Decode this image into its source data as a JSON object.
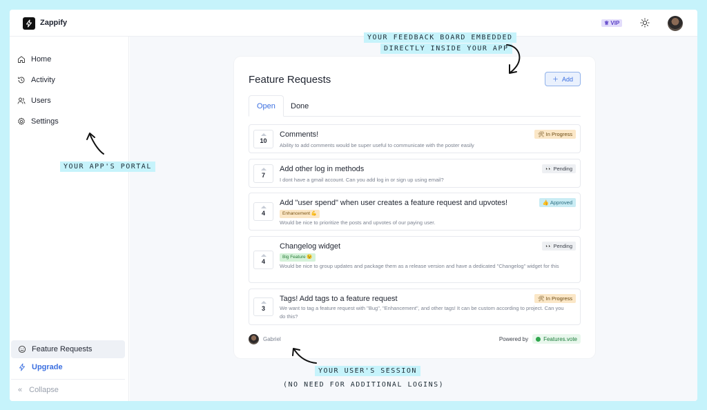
{
  "app": {
    "name": "Zappify",
    "vip_label": "VIP"
  },
  "sidebar": {
    "items": [
      {
        "label": "Home",
        "icon": "home-icon"
      },
      {
        "label": "Activity",
        "icon": "history-icon"
      },
      {
        "label": "Users",
        "icon": "users-icon"
      },
      {
        "label": "Settings",
        "icon": "gear-icon"
      }
    ],
    "feature_requests_label": "Feature Requests",
    "upgrade_label": "Upgrade",
    "collapse_label": "Collapse"
  },
  "board": {
    "title": "Feature Requests",
    "add_label": "Add",
    "tabs": [
      {
        "label": "Open",
        "active": true
      },
      {
        "label": "Done",
        "active": false
      }
    ],
    "requests": [
      {
        "votes": "10",
        "title": "Comments!",
        "tag": "",
        "desc": "Ability to add comments would be super useful to communicate with the poster easily",
        "status": "🛠 In Progress"
      },
      {
        "votes": "7",
        "title": "Add other log in methods",
        "tag": "",
        "desc": "I dont have a gmail account. Can you add log in or sign up using email?",
        "status": "👀 Pending"
      },
      {
        "votes": "4",
        "title": "Add \"user spend\" when user creates a feature request and upvotes!",
        "tag": "Enhancement 💪",
        "desc": "Would be nice to prioritize the posts and upvotes of our paying user.",
        "status": "👍 Approved"
      },
      {
        "votes": "4",
        "title": "Changelog widget",
        "tag": "Big Feature 😉",
        "desc": "Would be nice to group updates and package them as a release version and have a dedicated \"Changelog\" widget for this",
        "status": "👀 Pending"
      },
      {
        "votes": "3",
        "title": "Tags! Add tags to a feature request",
        "tag": "",
        "desc": "We want to tag a feature request with \"Bug\", \"Enhancement\", and other tags! It can be custom according to project. Can you do this?",
        "status": "🛠 In Progress"
      }
    ],
    "footer_user": "Gabriel",
    "powered_by": "Powered by",
    "powered_brand": "Features.vote"
  },
  "annotations": {
    "board_line1": "YOUR FEEDBACK BOARD EMBEDDED",
    "board_line2": "DIRECTLY INSIDE YOUR APP",
    "portal": "YOUR APP'S PORTAL",
    "session_line1": "YOUR USER'S SESSION",
    "session_line2": "(NO NEED FOR ADDITIONAL LOGINS)"
  },
  "colors": {
    "background": "#c6f3fb",
    "accent": "#3b6fe0"
  }
}
